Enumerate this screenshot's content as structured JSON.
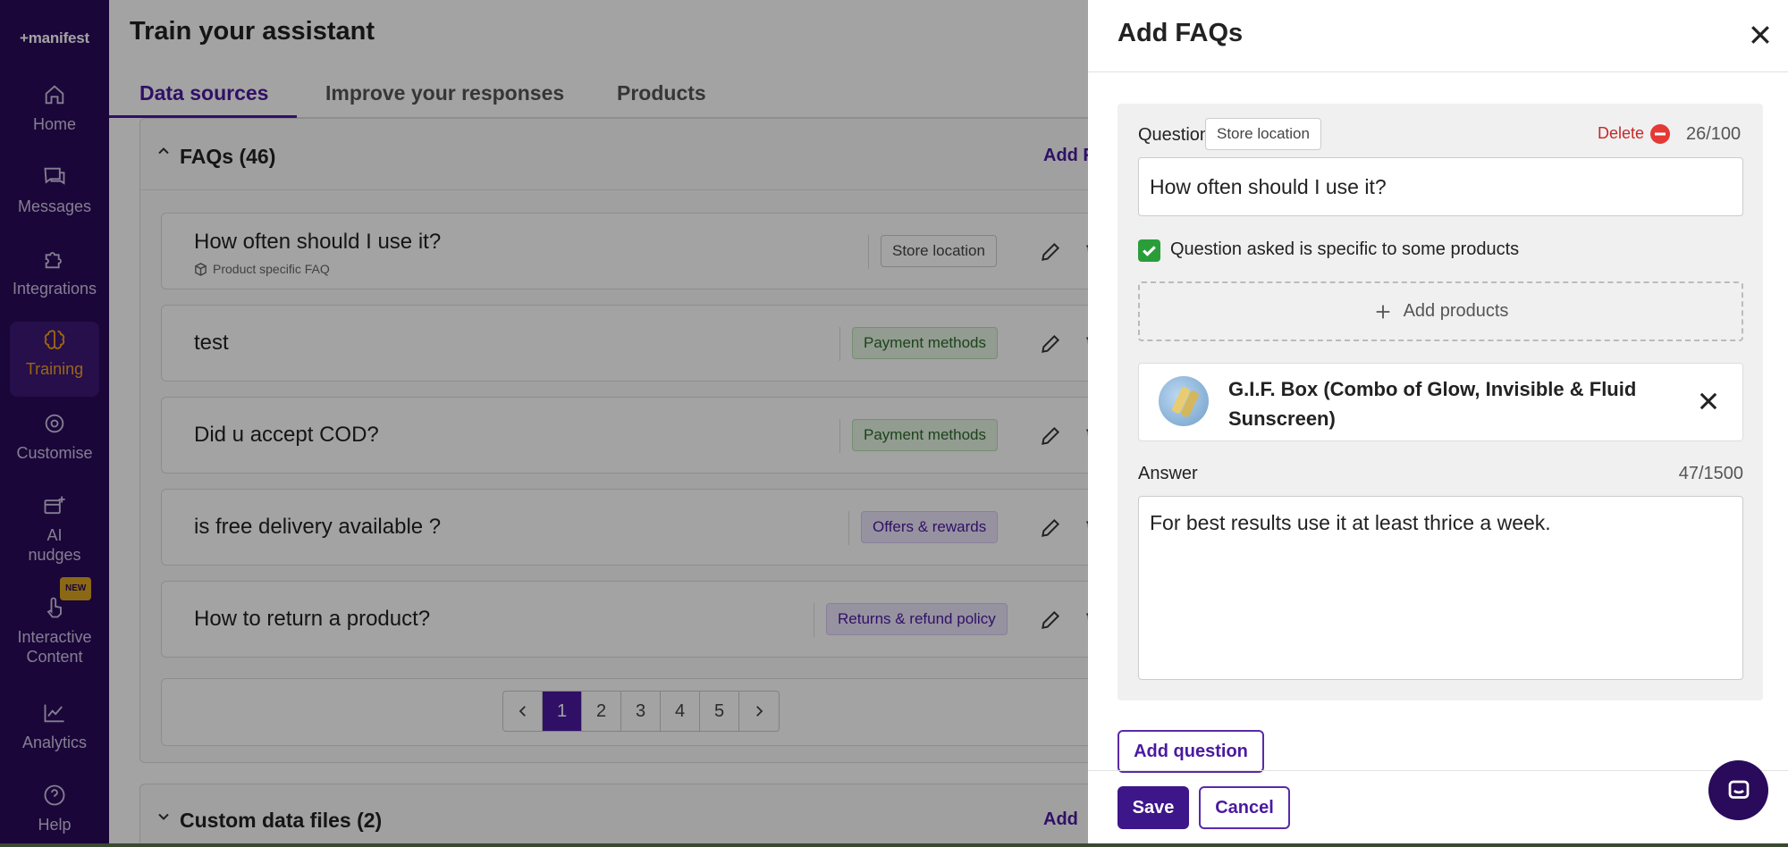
{
  "app": {
    "logo": "+manifest"
  },
  "sidebar": {
    "items": [
      {
        "label": "Home",
        "icon": "home-icon"
      },
      {
        "label": "Messages",
        "icon": "messages-icon"
      },
      {
        "label": "Integrations",
        "icon": "puzzle-icon"
      },
      {
        "label": "Training",
        "icon": "brain-icon",
        "active": true
      },
      {
        "label": "Customise",
        "icon": "gear-icon"
      },
      {
        "label": "AI nudges",
        "icon": "nudge-icon"
      },
      {
        "label": "Interactive Content",
        "icon": "hand-pointer-icon",
        "badge": "NEW"
      },
      {
        "label": "Analytics",
        "icon": "analytics-icon"
      },
      {
        "label": "Help",
        "icon": "help-icon"
      }
    ]
  },
  "main": {
    "title": "Train your assistant",
    "tabs": [
      {
        "label": "Data sources",
        "active": true
      },
      {
        "label": "Improve your responses"
      },
      {
        "label": "Products"
      }
    ],
    "faq_section": {
      "title": "FAQs (46)",
      "add_label": "Add F",
      "rows": [
        {
          "question": "How often should I use it?",
          "sub": "Product specific FAQ",
          "tag": "Store location",
          "tag_style": "grey"
        },
        {
          "question": "test",
          "tag": "Payment methods",
          "tag_style": "green"
        },
        {
          "question": "Did u accept COD?",
          "tag": "Payment methods",
          "tag_style": "green"
        },
        {
          "question": "is free delivery available ?",
          "tag": "Offers & rewards",
          "tag_style": "purple"
        },
        {
          "question": "How to return a product?",
          "tag": "Returns & refund policy",
          "tag_style": "purple"
        }
      ],
      "pagination": {
        "pages": [
          "1",
          "2",
          "3",
          "4",
          "5"
        ],
        "current": "1"
      }
    },
    "custom_section": {
      "title": "Custom data files (2)",
      "add_label": "Add"
    }
  },
  "drawer": {
    "title": "Add FAQs",
    "question_label": "Question",
    "question_tag": "Store location",
    "delete_label": "Delete",
    "question_count": "26/100",
    "question_value": "How often should I use it?",
    "specific_checkbox_label": "Question asked is specific to some products",
    "specific_checked": true,
    "add_products_label": "Add products",
    "product_name": "G.I.F. Box (Combo of Glow, Invisible & Fluid Sunscreen)",
    "answer_label": "Answer",
    "answer_count": "47/1500",
    "answer_value": "For best results use it at least thrice a week.",
    "add_question_label": "Add question",
    "save_label": "Save",
    "cancel_label": "Cancel"
  },
  "colors": {
    "brand": "#2a0a5a",
    "accent": "#4a1aa0",
    "active_nav": "#f0a020",
    "delete": "#c62828",
    "checkbox": "#2a9d3a"
  }
}
